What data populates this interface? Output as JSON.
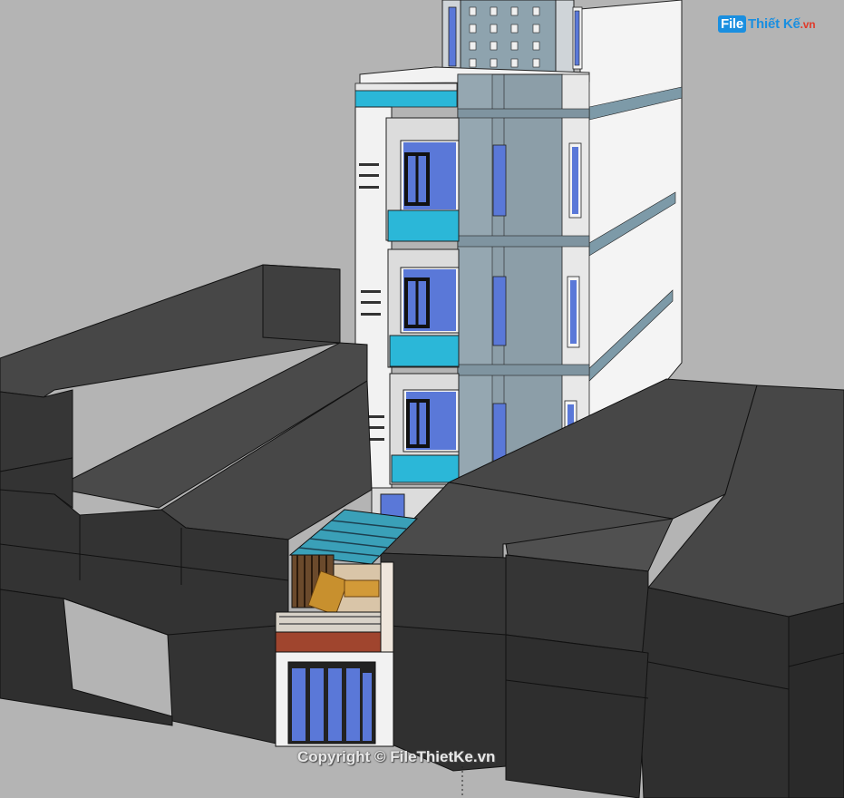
{
  "watermark": {
    "logo_text": "File Thiết Kế.vn",
    "logo_part1": "File",
    "logo_part2": "Thiết Kế",
    "logo_part3": ".vn",
    "copyright": "Copyright © FileThietKe.vn"
  },
  "colors": {
    "background": "#b4b4b4",
    "neighbor_dark": "#3a3a3a",
    "neighbor_top": "#4a4a4a",
    "facade_white": "#f2f2f2",
    "facade_grey": "#8c9ea8",
    "glass_cyan": "#2bb7d8",
    "window_blue": "#5a78d8",
    "accent": "#1a8fe0"
  }
}
